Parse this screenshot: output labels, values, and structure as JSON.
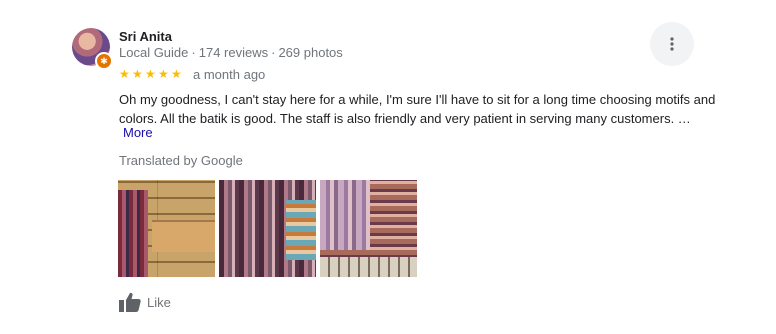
{
  "reviewer": {
    "name": "Sri Anita",
    "role": "Local Guide",
    "reviews": "174 reviews",
    "photos": "269 photos",
    "separator": "·"
  },
  "rating": {
    "stars": 5,
    "date": "a month ago",
    "star_color": "#fbbc04"
  },
  "review": {
    "text": "Oh my goodness, I can't stay here for a while, I'm sure I'll have to sit for a long time choosing motifs and colors. All the batik is good. The staff is also friendly and very patient in serving many customers. …",
    "more_label": "More",
    "translated_note": "Translated by Google"
  },
  "photos": [
    {
      "icon": "batik-shop-photo-1"
    },
    {
      "icon": "batik-shop-photo-2"
    },
    {
      "icon": "batik-shop-photo-3"
    }
  ],
  "actions": {
    "like_label": "Like",
    "menu_icon": "more-vert-icon",
    "like_icon": "thumbs-up-icon"
  },
  "colors": {
    "link": "#1a0dab",
    "secondary_text": "#70757a",
    "badge": "#e37400"
  }
}
